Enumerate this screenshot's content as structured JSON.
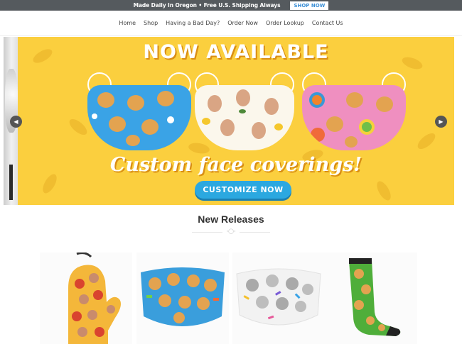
{
  "announcement": {
    "message": "Made Daily In Oregon • Free U.S. Shipping Always",
    "button_label": "SHOP NOW",
    "button_color": "#3b8fd6"
  },
  "nav": {
    "items": [
      "Home",
      "Shop",
      "Having a Bad Day?",
      "Order Now",
      "Order Lookup",
      "Contact Us"
    ]
  },
  "hero": {
    "headline": "NOW AVAILABLE",
    "tagline": "Custom face coverings!",
    "cta_label": "CUSTOMIZE NOW",
    "background_color": "#fbcf3e",
    "cta_color": "#2ba8e0",
    "prev_icon": "chevron-left-icon",
    "next_icon": "chevron-right-icon",
    "masks": [
      {
        "name": "blue dog mask",
        "color": "#3aa3e6"
      },
      {
        "name": "white lemon face mask",
        "color": "#fbf7ec"
      },
      {
        "name": "pink donut dog mask",
        "color": "#ef8fc0"
      }
    ]
  },
  "new_releases": {
    "title": "New Releases",
    "products": [
      {
        "name": "oven mitt",
        "color": "#f4b73a"
      },
      {
        "name": "blue dog face mask",
        "color": "#3a9edc"
      },
      {
        "name": "cat face mask",
        "color": "#f2f2f2"
      },
      {
        "name": "dog socks",
        "color": "#4fae3a"
      }
    ]
  }
}
